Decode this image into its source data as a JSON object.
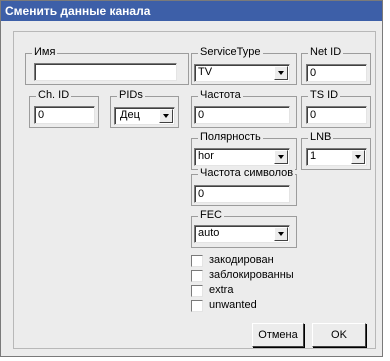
{
  "window": {
    "title": "Сменить данные канала"
  },
  "groups": {
    "name": {
      "label": "Имя",
      "value": ""
    },
    "service_type": {
      "label": "ServiceType",
      "value": "TV"
    },
    "net_id": {
      "label": "Net ID",
      "value": "0"
    },
    "ch_id": {
      "label": "Ch. ID",
      "value": "0"
    },
    "pids": {
      "label": "PIDs",
      "value": "Дец"
    },
    "frequency": {
      "label": "Частота",
      "value": "0"
    },
    "ts_id": {
      "label": "TS ID",
      "value": "0"
    },
    "polarity": {
      "label": "Полярность",
      "value": "hor"
    },
    "lnb": {
      "label": "LNB",
      "value": "1"
    },
    "symbol_rate": {
      "label": "Частота символов",
      "value": "0"
    },
    "fec": {
      "label": "FEC",
      "value": "auto"
    }
  },
  "checkboxes": [
    {
      "label": "закодирован",
      "checked": false
    },
    {
      "label": "заблокированны",
      "checked": false
    },
    {
      "label": "extra",
      "checked": false
    },
    {
      "label": "unwanted",
      "checked": false
    }
  ],
  "buttons": {
    "cancel": "Отмена",
    "ok": "OK"
  }
}
